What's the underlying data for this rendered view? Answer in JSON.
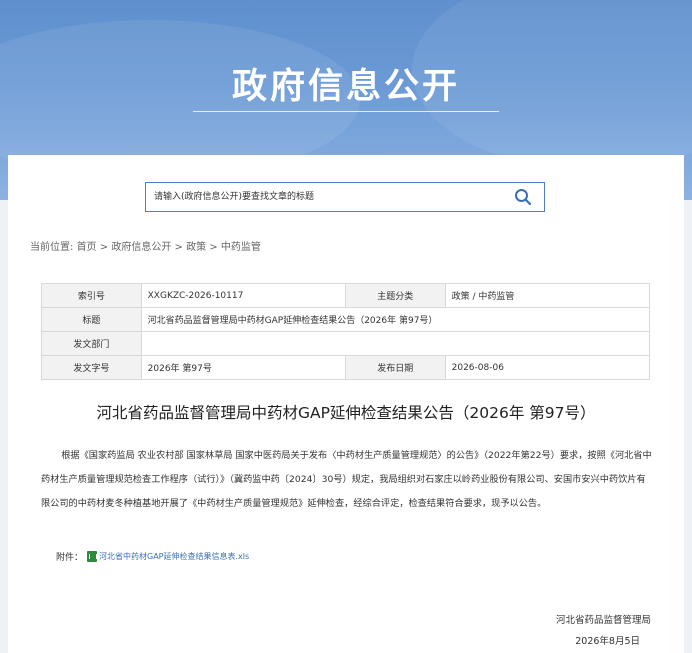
{
  "banner": {
    "title": "政府信息公开"
  },
  "search": {
    "placeholder": "请输入(政府信息公开)要查找文章的标题"
  },
  "breadcrumb": {
    "prefix": "当前位置:",
    "items": [
      "首页",
      "政府信息公开",
      "政策",
      "中药监管"
    ],
    "separator": ">"
  },
  "info": {
    "index_label": "索引号",
    "index_value": "XXGKZC-2026-10117",
    "category_label": "主题分类",
    "category_value": "政策 / 中药监管",
    "title_label": "标题",
    "title_value": "河北省药品监督管理局中药材GAP延伸检查结果公告（2026年 第97号）",
    "dept_label": "发文部门",
    "dept_value": "",
    "docno_label": "发文字号",
    "docno_value": "2026年 第97号",
    "date_label": "发布日期",
    "date_value": "2026-08-06"
  },
  "article": {
    "title": "河北省药品监督管理局中药材GAP延伸检查结果公告（2026年 第97号）",
    "body": "根据《国家药监局 农业农村部 国家林草局 国家中医药局关于发布〈中药材生产质量管理规范〉的公告》（2022年第22号）要求，按照《河北省中药材生产质量管理规范检查工作程序（试行）》（冀药监中药〔2024〕30号）规定，我局组织对石家庄以岭药业股份有限公司、安国市安兴中药饮片有限公司的中药材麦冬种植基地开展了《中药材生产质量管理规范》延伸检查，经综合评定，检查结果符合要求，现予以公告。",
    "attach_label": "附件：",
    "attach_link": "河北省中药材GAP延伸检查结果信息表.xls",
    "sign_org": "河北省药品监督管理局",
    "sign_date": "2026年8月5日"
  }
}
